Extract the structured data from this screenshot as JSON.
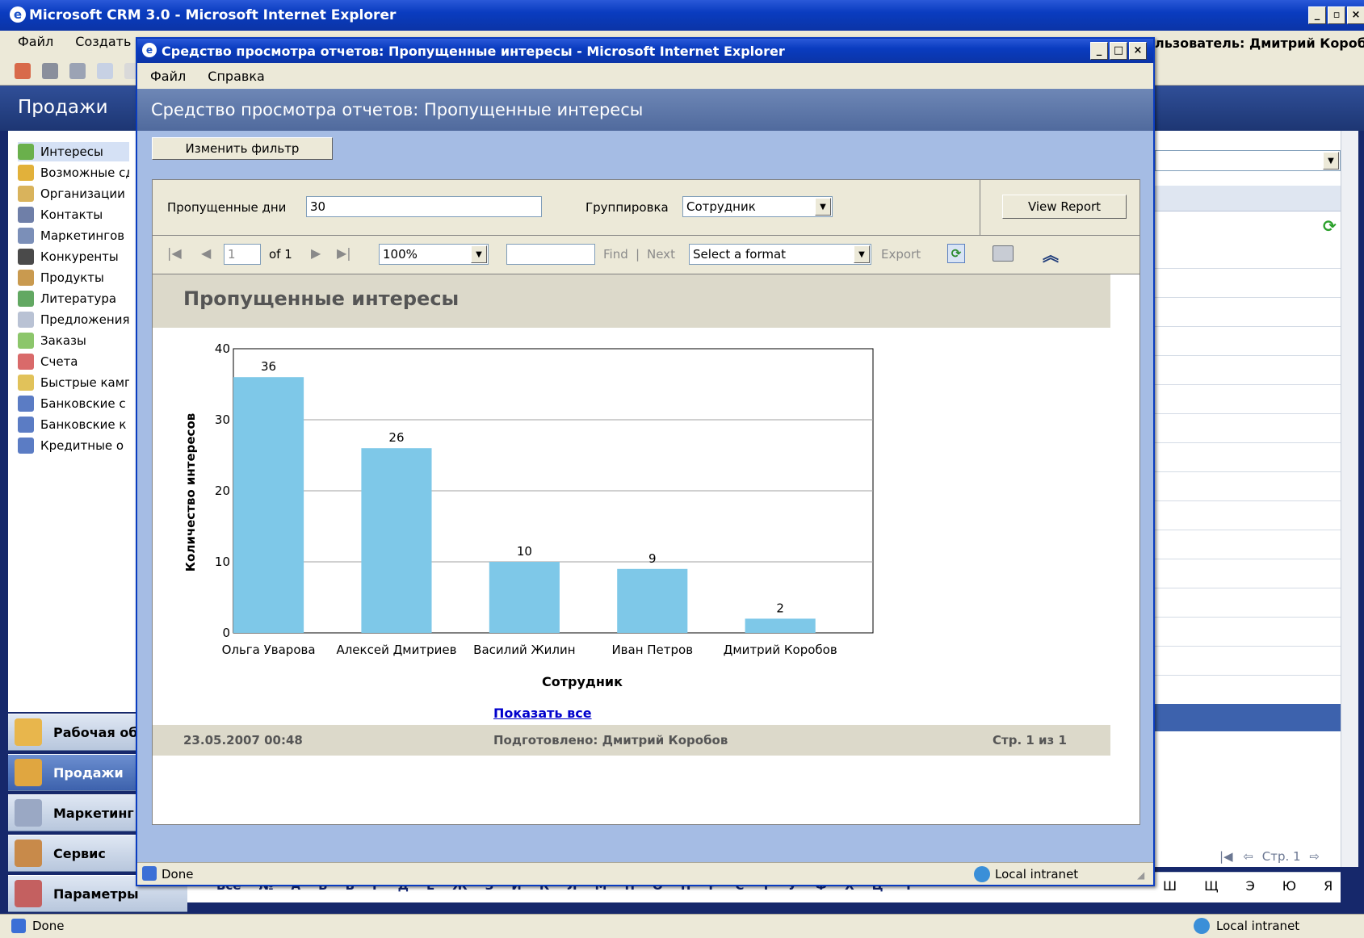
{
  "outer": {
    "title": "Microsoft CRM 3.0 - Microsoft Internet Explorer",
    "menu": [
      "Файл",
      "Создать"
    ],
    "user_label": "льзователь: Дмитрий Коробов",
    "area_title": "Продажи",
    "nav_items": [
      "Интересы",
      "Возможные сд",
      "Организации",
      "Контакты",
      "Маркетингов",
      "Конкуренты",
      "Продукты",
      "Литература",
      "Предложения",
      "Заказы",
      "Счета",
      "Быстрые камп",
      "Банковские с",
      "Банковские к",
      "Кредитные о"
    ],
    "wunderbar": [
      "Рабочая об",
      "Продажи",
      "Маркетинг",
      "Сервис",
      "Параметры"
    ],
    "alphabet_left": [
      "Все",
      "№",
      "А",
      "Б",
      "В",
      "Г",
      "Д",
      "Е",
      "Ж",
      "З",
      "И",
      "К",
      "Л",
      "М",
      "Н",
      "О",
      "П",
      "Р",
      "С",
      "Т",
      "У",
      "Ф",
      "Х",
      "Ц",
      "Ч"
    ],
    "alphabet_right": [
      "Ш",
      "Щ",
      "Э",
      "Ю",
      "Я"
    ],
    "page_label": "Стр. 1",
    "status": "Done",
    "zone": "Local intranet"
  },
  "popup": {
    "title": "Средство просмотра отчетов: Пропущенные интересы - Microsoft Internet Explorer",
    "menu": [
      "Файл",
      "Справка"
    ],
    "header": "Средство просмотра отчетов: Пропущенные интересы",
    "filter_button": "Изменить фильтр",
    "param1_label": "Пропущенные дни",
    "param1_value": "30",
    "param2_label": "Группировка",
    "param2_value": "Сотрудник",
    "view_report": "View Report",
    "page_input": "1",
    "page_of": "of 1",
    "zoom": "100%",
    "find": "Find",
    "sep": "|",
    "next": "Next",
    "format": "Select a format",
    "export": "Export",
    "report_title": "Пропущенные интересы",
    "show_all": "Показать все",
    "footer_date": "23.05.2007 00:48",
    "footer_prepared": "Подготовлено: Дмитрий Коробов",
    "footer_page": "Стр. 1 из 1",
    "status": "Done",
    "zone": "Local intranet"
  },
  "chart_data": {
    "type": "bar",
    "categories": [
      "Ольга Уварова",
      "Алексей Дмитриев",
      "Василий Жилин",
      "Иван Петров",
      "Дмитрий Коробов"
    ],
    "values": [
      36,
      26,
      10,
      9,
      2
    ],
    "xlabel": "Сотрудник",
    "ylabel": "Количество интересов",
    "ylim": [
      0,
      40
    ],
    "yticks": [
      0,
      10,
      20,
      30,
      40
    ],
    "grid": true,
    "color": "#7ec8e8"
  }
}
